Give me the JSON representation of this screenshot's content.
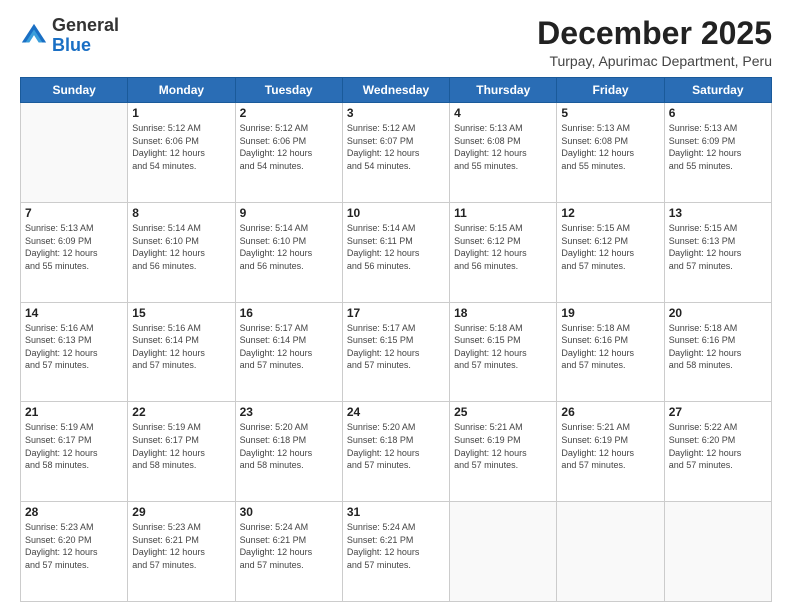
{
  "logo": {
    "general": "General",
    "blue": "Blue"
  },
  "header": {
    "title": "December 2025",
    "subtitle": "Turpay, Apurimac Department, Peru"
  },
  "days_of_week": [
    "Sunday",
    "Monday",
    "Tuesday",
    "Wednesday",
    "Thursday",
    "Friday",
    "Saturday"
  ],
  "weeks": [
    [
      {
        "day": "",
        "info": ""
      },
      {
        "day": "1",
        "info": "Sunrise: 5:12 AM\nSunset: 6:06 PM\nDaylight: 12 hours\nand 54 minutes."
      },
      {
        "day": "2",
        "info": "Sunrise: 5:12 AM\nSunset: 6:06 PM\nDaylight: 12 hours\nand 54 minutes."
      },
      {
        "day": "3",
        "info": "Sunrise: 5:12 AM\nSunset: 6:07 PM\nDaylight: 12 hours\nand 54 minutes."
      },
      {
        "day": "4",
        "info": "Sunrise: 5:13 AM\nSunset: 6:08 PM\nDaylight: 12 hours\nand 55 minutes."
      },
      {
        "day": "5",
        "info": "Sunrise: 5:13 AM\nSunset: 6:08 PM\nDaylight: 12 hours\nand 55 minutes."
      },
      {
        "day": "6",
        "info": "Sunrise: 5:13 AM\nSunset: 6:09 PM\nDaylight: 12 hours\nand 55 minutes."
      }
    ],
    [
      {
        "day": "7",
        "info": "Sunrise: 5:13 AM\nSunset: 6:09 PM\nDaylight: 12 hours\nand 55 minutes."
      },
      {
        "day": "8",
        "info": "Sunrise: 5:14 AM\nSunset: 6:10 PM\nDaylight: 12 hours\nand 56 minutes."
      },
      {
        "day": "9",
        "info": "Sunrise: 5:14 AM\nSunset: 6:10 PM\nDaylight: 12 hours\nand 56 minutes."
      },
      {
        "day": "10",
        "info": "Sunrise: 5:14 AM\nSunset: 6:11 PM\nDaylight: 12 hours\nand 56 minutes."
      },
      {
        "day": "11",
        "info": "Sunrise: 5:15 AM\nSunset: 6:12 PM\nDaylight: 12 hours\nand 56 minutes."
      },
      {
        "day": "12",
        "info": "Sunrise: 5:15 AM\nSunset: 6:12 PM\nDaylight: 12 hours\nand 57 minutes."
      },
      {
        "day": "13",
        "info": "Sunrise: 5:15 AM\nSunset: 6:13 PM\nDaylight: 12 hours\nand 57 minutes."
      }
    ],
    [
      {
        "day": "14",
        "info": "Sunrise: 5:16 AM\nSunset: 6:13 PM\nDaylight: 12 hours\nand 57 minutes."
      },
      {
        "day": "15",
        "info": "Sunrise: 5:16 AM\nSunset: 6:14 PM\nDaylight: 12 hours\nand 57 minutes."
      },
      {
        "day": "16",
        "info": "Sunrise: 5:17 AM\nSunset: 6:14 PM\nDaylight: 12 hours\nand 57 minutes."
      },
      {
        "day": "17",
        "info": "Sunrise: 5:17 AM\nSunset: 6:15 PM\nDaylight: 12 hours\nand 57 minutes."
      },
      {
        "day": "18",
        "info": "Sunrise: 5:18 AM\nSunset: 6:15 PM\nDaylight: 12 hours\nand 57 minutes."
      },
      {
        "day": "19",
        "info": "Sunrise: 5:18 AM\nSunset: 6:16 PM\nDaylight: 12 hours\nand 57 minutes."
      },
      {
        "day": "20",
        "info": "Sunrise: 5:18 AM\nSunset: 6:16 PM\nDaylight: 12 hours\nand 58 minutes."
      }
    ],
    [
      {
        "day": "21",
        "info": "Sunrise: 5:19 AM\nSunset: 6:17 PM\nDaylight: 12 hours\nand 58 minutes."
      },
      {
        "day": "22",
        "info": "Sunrise: 5:19 AM\nSunset: 6:17 PM\nDaylight: 12 hours\nand 58 minutes."
      },
      {
        "day": "23",
        "info": "Sunrise: 5:20 AM\nSunset: 6:18 PM\nDaylight: 12 hours\nand 58 minutes."
      },
      {
        "day": "24",
        "info": "Sunrise: 5:20 AM\nSunset: 6:18 PM\nDaylight: 12 hours\nand 57 minutes."
      },
      {
        "day": "25",
        "info": "Sunrise: 5:21 AM\nSunset: 6:19 PM\nDaylight: 12 hours\nand 57 minutes."
      },
      {
        "day": "26",
        "info": "Sunrise: 5:21 AM\nSunset: 6:19 PM\nDaylight: 12 hours\nand 57 minutes."
      },
      {
        "day": "27",
        "info": "Sunrise: 5:22 AM\nSunset: 6:20 PM\nDaylight: 12 hours\nand 57 minutes."
      }
    ],
    [
      {
        "day": "28",
        "info": "Sunrise: 5:23 AM\nSunset: 6:20 PM\nDaylight: 12 hours\nand 57 minutes."
      },
      {
        "day": "29",
        "info": "Sunrise: 5:23 AM\nSunset: 6:21 PM\nDaylight: 12 hours\nand 57 minutes."
      },
      {
        "day": "30",
        "info": "Sunrise: 5:24 AM\nSunset: 6:21 PM\nDaylight: 12 hours\nand 57 minutes."
      },
      {
        "day": "31",
        "info": "Sunrise: 5:24 AM\nSunset: 6:21 PM\nDaylight: 12 hours\nand 57 minutes."
      },
      {
        "day": "",
        "info": ""
      },
      {
        "day": "",
        "info": ""
      },
      {
        "day": "",
        "info": ""
      }
    ]
  ]
}
